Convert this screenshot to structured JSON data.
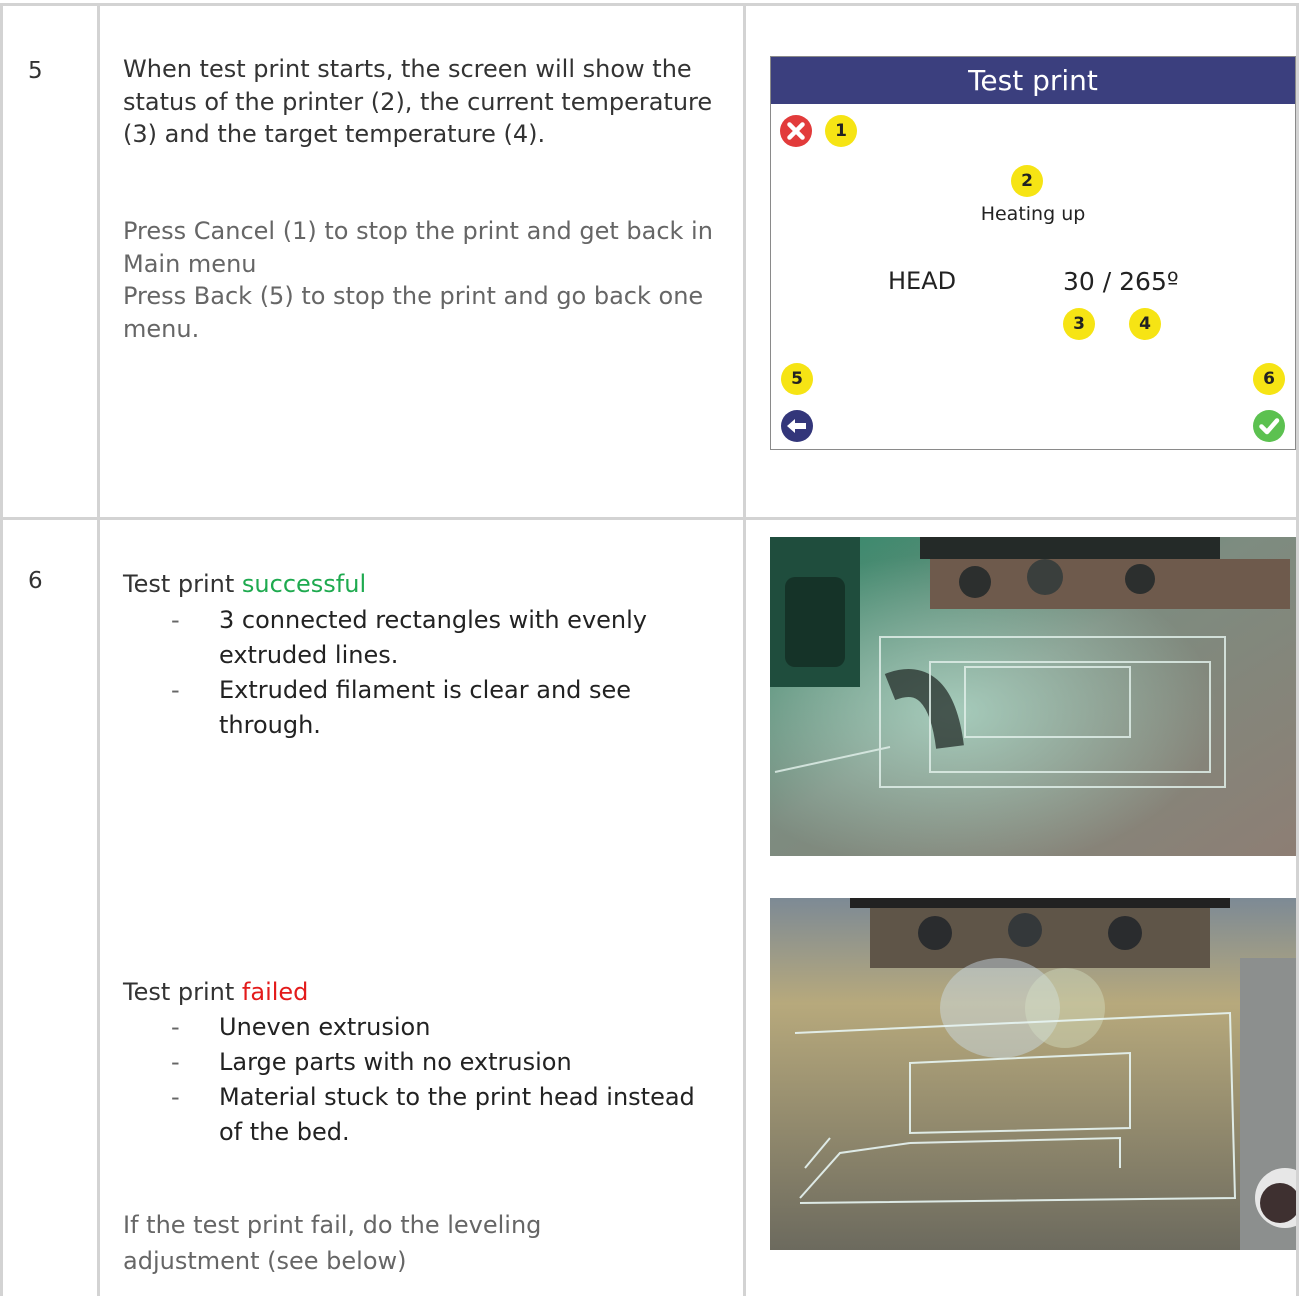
{
  "row5": {
    "step_number": "5",
    "paragraph1": "When test print starts, the screen will show the status of the printer (2), the current temperature (3) and the target temperature (4).",
    "paragraph2": "Press Cancel (1) to stop the print and get back in Main menu\nPress Back (5) to stop the print and go back one menu.",
    "device_screen": {
      "title": "Test print",
      "status_text": "Heating up",
      "head_label": "HEAD",
      "temperature": "30 / 265º",
      "callouts": [
        "1",
        "2",
        "3",
        "4",
        "5",
        "6"
      ],
      "icons": {
        "cancel": "close-circle-icon",
        "back": "arrow-left-circle-icon",
        "confirm": "check-circle-icon"
      },
      "colors": {
        "title_bar": "#3b3f7e",
        "callout": "#f6e414",
        "cancel": "#e23b3b",
        "confirm": "#5cc150"
      }
    }
  },
  "row6": {
    "step_number": "6",
    "success": {
      "heading_prefix": "Test print ",
      "heading_status": "successful",
      "bullets": [
        "3 connected rectangles with evenly extruded lines.",
        "Extruded filament is clear and see through."
      ]
    },
    "failure": {
      "heading_prefix": "Test print ",
      "heading_status": "failed",
      "bullets": [
        "Uneven extrusion",
        "Large parts with no extrusion",
        "Material stuck to the print head instead of the bed."
      ]
    },
    "note": "If the test print fail, do the leveling adjustment (see below)",
    "bullet_marker": "-",
    "colors": {
      "success": "#1eaa4f",
      "failed": "#e31b1b"
    }
  }
}
